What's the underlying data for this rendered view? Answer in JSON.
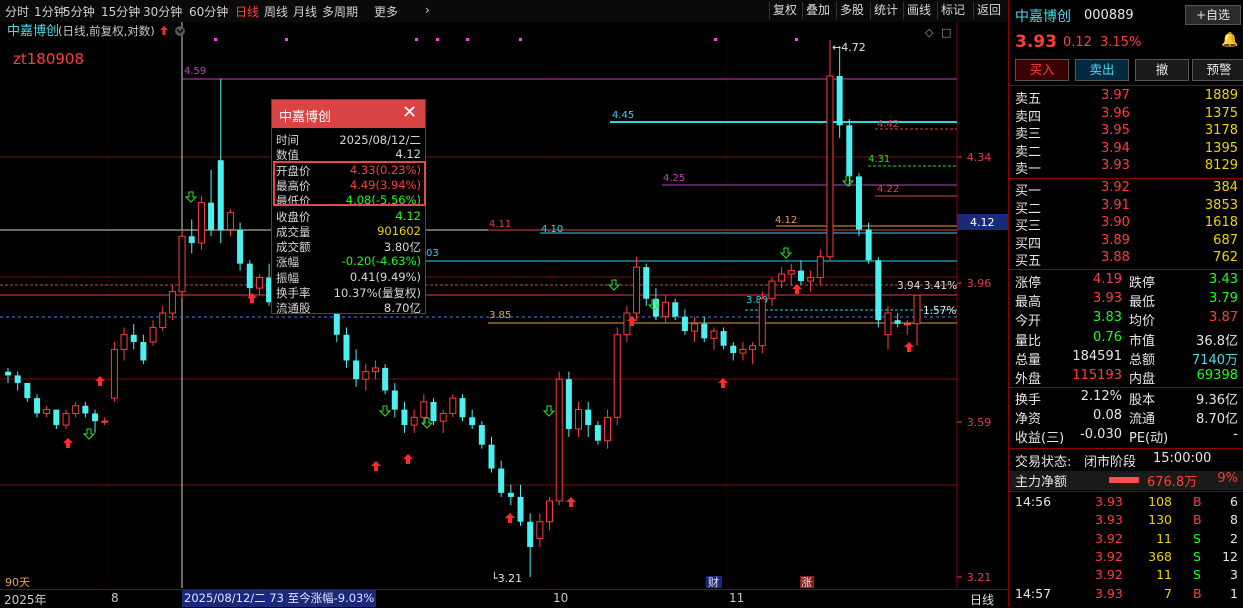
{
  "toolbar": {
    "periods": [
      "分时",
      "1分钟",
      "5分钟",
      "15分钟",
      "30分钟",
      "60分钟",
      "日线",
      "周线",
      "月线",
      "多周期",
      "更多"
    ],
    "active_period": "日线",
    "tools": [
      "复权",
      "叠加",
      "多股",
      "统计",
      "画线",
      "标记",
      "返回"
    ]
  },
  "chart": {
    "title_name": "中嘉博创",
    "title_mode": "(日线,前复权,对数)",
    "user_tag": "zt180908",
    "price_axis": [
      "4.34",
      "3.96",
      "3.59",
      "3.21"
    ],
    "current_price_tag": "4.12",
    "hline_labels": {
      "l459": "4.59",
      "l445": "4.45",
      "l442": "4.42",
      "l431": "4.31",
      "l425": "4.25",
      "l422": "4.22",
      "l412": "4.12",
      "l411": "4.11",
      "l410": "4.10",
      "l403": "03",
      "l394": "3.94",
      "l394pct": "3.41%",
      "l389": "3.89",
      "l385": "3.85",
      "l157pct": "1.57%"
    },
    "high_label": "4.72",
    "low_label": "3.21",
    "days_label": "90天",
    "event_labels": {
      "cai": "财",
      "zhang": "涨"
    }
  },
  "bottom_axis": {
    "year": "2025年",
    "months": [
      "8",
      "10",
      "11"
    ],
    "cursor_info": "2025/08/12/二 73 至今涨幅-9.03%",
    "period_label": "日线"
  },
  "popup": {
    "title": "中嘉博创",
    "rows": [
      {
        "label": "时间",
        "value": "2025/08/12/二",
        "color": "#d6d6d6"
      },
      {
        "label": "数值",
        "value": "4.12",
        "color": "#d6d6d6"
      },
      {
        "label": "开盘价",
        "value": "4.33(0.23%)",
        "color": "#ff3c3c"
      },
      {
        "label": "最高价",
        "value": "4.49(3.94%)",
        "color": "#ff3c3c"
      },
      {
        "label": "最低价",
        "value": "4.08(-5.56%)",
        "color": "#19ff19"
      },
      {
        "label": "收盘价",
        "value": "4.12",
        "color": "#19ff19"
      },
      {
        "label": "成交量",
        "value": "901602",
        "color": "#f0d200"
      },
      {
        "label": "成交额",
        "value": "3.80亿",
        "color": "#d6d6d6"
      },
      {
        "label": "涨幅",
        "value": "-0.20(-4.63%)",
        "color": "#19ff19"
      },
      {
        "label": "振幅",
        "value": "0.41(9.49%)",
        "color": "#d6d6d6"
      },
      {
        "label": "换手率",
        "value": "10.37%(量复权)",
        "color": "#d6d6d6"
      },
      {
        "label": "流通股",
        "value": "8.70亿",
        "color": "#d6d6d6"
      }
    ]
  },
  "quote": {
    "name": "中嘉博创",
    "code": "000889",
    "self_select": "自选",
    "price": "3.93",
    "change": "0.12",
    "change_pct": "3.15%",
    "actions": [
      "买入",
      "卖出",
      "撤",
      "预警"
    ],
    "asks": [
      {
        "label": "卖五",
        "price": "3.97",
        "vol": "1889"
      },
      {
        "label": "卖四",
        "price": "3.96",
        "vol": "1375"
      },
      {
        "label": "卖三",
        "price": "3.95",
        "vol": "3178"
      },
      {
        "label": "卖二",
        "price": "3.94",
        "vol": "1395"
      },
      {
        "label": "卖一",
        "price": "3.93",
        "vol": "8129"
      }
    ],
    "bids": [
      {
        "label": "买一",
        "price": "3.92",
        "vol": "384"
      },
      {
        "label": "买二",
        "price": "3.91",
        "vol": "3853"
      },
      {
        "label": "买三",
        "price": "3.90",
        "vol": "1618"
      },
      {
        "label": "买四",
        "price": "3.89",
        "vol": "687"
      },
      {
        "label": "买五",
        "price": "3.88",
        "vol": "762"
      }
    ],
    "stats": [
      {
        "l1": "涨停",
        "v1": "4.19",
        "c1": "#ff3c3c",
        "l2": "跌停",
        "v2": "3.43",
        "c2": "#19ff19"
      },
      {
        "l1": "最高",
        "v1": "3.93",
        "c1": "#ff3c3c",
        "l2": "最低",
        "v2": "3.79",
        "c2": "#19ff19"
      },
      {
        "l1": "今开",
        "v1": "3.83",
        "c1": "#19ff19",
        "l2": "均价",
        "v2": "3.87",
        "c2": "#ff3c3c"
      },
      {
        "l1": "量比",
        "v1": "0.76",
        "c1": "#19ff19",
        "l2": "市值",
        "v2": "36.8亿",
        "c2": "#e6e6e6"
      },
      {
        "l1": "总量",
        "v1": "184591",
        "c1": "#e6e6e6",
        "l2": "总额",
        "v2": "7140万",
        "c2": "#4dd8e8"
      },
      {
        "l1": "外盘",
        "v1": "115193",
        "c1": "#ff3c3c",
        "l2": "内盘",
        "v2": "69398",
        "c2": "#19ff19"
      }
    ],
    "stats2": [
      {
        "l1": "换手",
        "v1": "2.12%",
        "c1": "#e6e6e6",
        "l2": "股本",
        "v2": "9.36亿",
        "c2": "#e6e6e6"
      },
      {
        "l1": "净资",
        "v1": "0.08",
        "c1": "#e6e6e6",
        "l2": "流通",
        "v2": "8.70亿",
        "c2": "#e6e6e6"
      },
      {
        "l1": "收益(三)",
        "v1": "-0.030",
        "c1": "#e6e6e6",
        "l2": "PE(动)",
        "v2": "-",
        "c2": "#e6e6e6"
      }
    ],
    "trade_state_label": "交易状态:",
    "trade_state": "闭市阶段",
    "trade_time": "15:00:00",
    "main_flow_label": "主力净额",
    "main_flow_value": "676.8万",
    "main_flow_pct": "9%",
    "ticks": [
      {
        "time": "14:56",
        "price": "3.93",
        "vol": "108",
        "side": "B",
        "n": "6",
        "pc": "#ff3c3c",
        "sc": "#ff3c3c"
      },
      {
        "time": "",
        "price": "3.93",
        "vol": "130",
        "side": "B",
        "n": "8",
        "pc": "#ff3c3c",
        "sc": "#ff3c3c"
      },
      {
        "time": "",
        "price": "3.92",
        "vol": "11",
        "side": "S",
        "n": "2",
        "pc": "#ff3c3c",
        "sc": "#19ff19"
      },
      {
        "time": "",
        "price": "3.92",
        "vol": "368",
        "side": "S",
        "n": "12",
        "pc": "#ff3c3c",
        "sc": "#19ff19"
      },
      {
        "time": "",
        "price": "3.92",
        "vol": "11",
        "side": "S",
        "n": "3",
        "pc": "#ff3c3c",
        "sc": "#19ff19"
      },
      {
        "time": "14:57",
        "price": "3.93",
        "vol": "7",
        "side": "B",
        "n": "1",
        "pc": "#ff3c3c",
        "sc": "#ff3c3c"
      }
    ]
  }
}
